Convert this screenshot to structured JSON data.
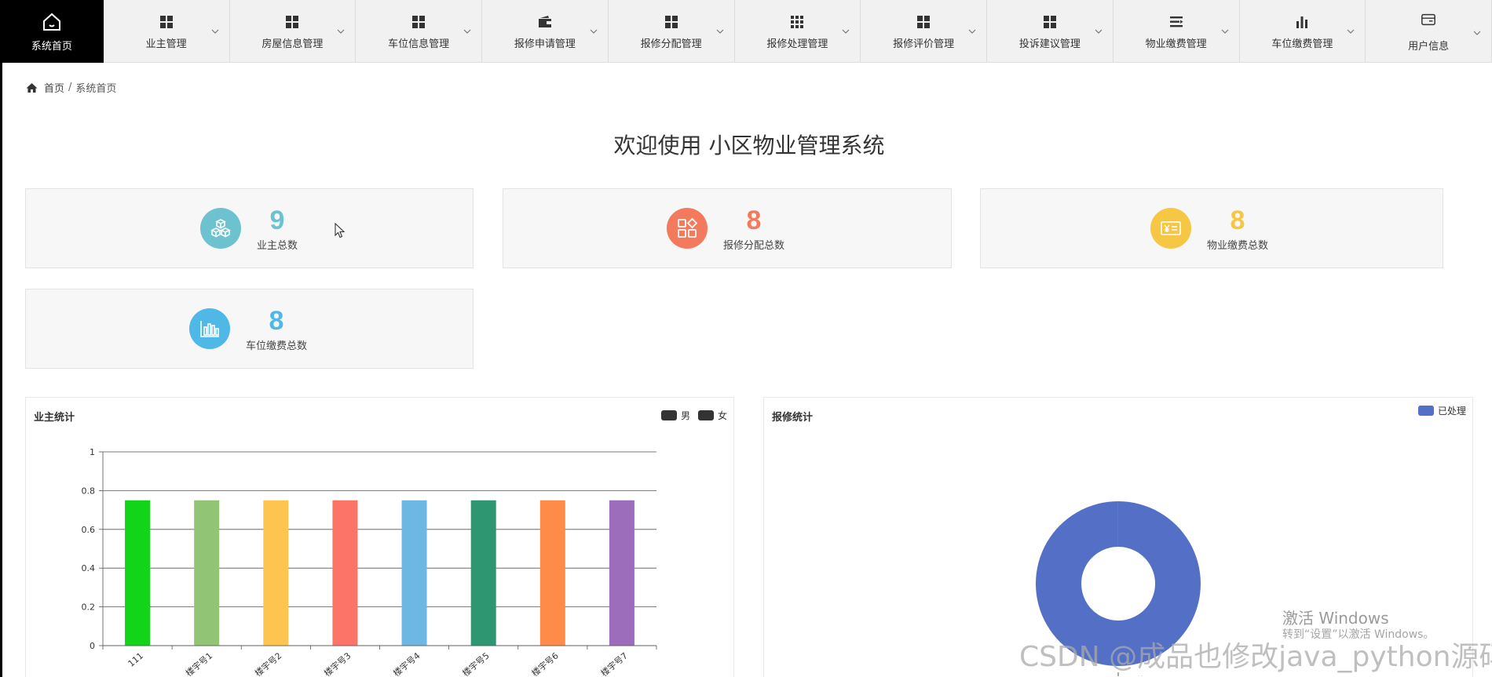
{
  "nav": {
    "home_label": "系统首页",
    "items": [
      {
        "label": "业主管理",
        "icon": "grid-icon"
      },
      {
        "label": "房屋信息管理",
        "icon": "grid-icon"
      },
      {
        "label": "车位信息管理",
        "icon": "grid-icon"
      },
      {
        "label": "报修申请管理",
        "icon": "wallet-icon"
      },
      {
        "label": "报修分配管理",
        "icon": "grid-icon"
      },
      {
        "label": "报修处理管理",
        "icon": "grid-9-icon"
      },
      {
        "label": "报修评价管理",
        "icon": "grid-icon"
      },
      {
        "label": "投诉建议管理",
        "icon": "grid-icon"
      },
      {
        "label": "物业缴费管理",
        "icon": "menu-lines-icon"
      },
      {
        "label": "车位缴费管理",
        "icon": "bar-chart-icon"
      },
      {
        "label": "用户信息",
        "icon": "card-icon"
      }
    ]
  },
  "breadcrumb": {
    "home": "首页",
    "separator": "/",
    "current": "系统首页"
  },
  "title": "欢迎使用 小区物业管理系统",
  "stats": [
    {
      "value": "9",
      "label": "业主总数",
      "color": "#6cc3cf",
      "icon": "cubes-icon"
    },
    {
      "value": "8",
      "label": "报修分配总数",
      "color": "#f47a5e",
      "icon": "apps-icon"
    },
    {
      "value": "8",
      "label": "物业缴费总数",
      "color": "#f6c745",
      "icon": "yen-bill-icon"
    },
    {
      "value": "8",
      "label": "车位缴费总数",
      "color": "#4fb8e7",
      "icon": "bar-chart-icon"
    }
  ],
  "owner_chart": {
    "title": "业主统计",
    "legend": [
      {
        "label": "男",
        "color": "#333333"
      },
      {
        "label": "女",
        "color": "#333333"
      }
    ]
  },
  "repair_chart": {
    "title": "报修统计",
    "legend": [
      {
        "label": "已处理",
        "color": "#5470c6"
      }
    ]
  },
  "chart_data": [
    {
      "type": "bar",
      "title": "业主统计",
      "categories": [
        "111",
        "楼宇号1",
        "楼宇号2",
        "楼宇号3",
        "楼宇号4",
        "楼宇号5",
        "楼宇号6",
        "楼宇号7"
      ],
      "values": [
        0.75,
        0.75,
        0.75,
        0.75,
        0.75,
        0.75,
        0.75,
        0.75
      ],
      "colors": [
        "#12d418",
        "#91c474",
        "#fdc450",
        "#fc7468",
        "#6db8e2",
        "#2f9672",
        "#fe8b48",
        "#9c6dba"
      ],
      "yticks": [
        "0",
        "0.2",
        "0.4",
        "0.6",
        "0.8",
        "1"
      ],
      "ylim": [
        0,
        1
      ],
      "grid": true,
      "legend": [
        "男",
        "女"
      ],
      "legend_position": "top-right"
    },
    {
      "type": "pie",
      "title": "报修统计",
      "labels": [
        "已处理"
      ],
      "values": [
        1
      ],
      "colors": [
        "#5470c6"
      ],
      "donut": true,
      "legend": [
        "已处理"
      ],
      "legend_position": "top-right"
    }
  ],
  "watermark": {
    "activate_title": "激活 Windows",
    "activate_sub": "转到“设置”以激活 Windows。",
    "csdn": "CSDN @成品也修改java_python源码"
  }
}
